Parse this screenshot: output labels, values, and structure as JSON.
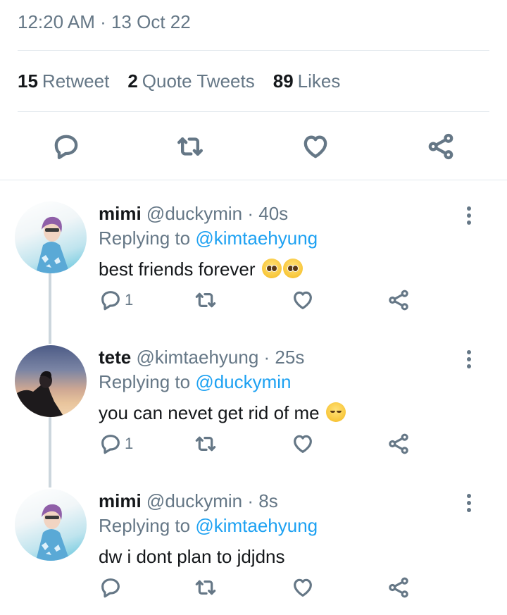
{
  "tweet": {
    "timestamp": "12:20 AM · 13 Oct 22",
    "stats": {
      "retweets_count": "15",
      "retweets_label": "Retweet",
      "quotes_count": "2",
      "quotes_label": "Quote Tweets",
      "likes_count": "89",
      "likes_label": "Likes"
    },
    "actions": [
      "reply-icon",
      "retweet-icon",
      "like-icon",
      "share-icon"
    ]
  },
  "colors": {
    "secondary_text": "#657786",
    "mention": "#1da1f2",
    "divider": "#e1e8ed",
    "thread_line": "#ccd6dd"
  },
  "replies": [
    {
      "name": "mimi",
      "handle": "@duckymin",
      "time": "· 40s",
      "replying_prefix": "Replying to",
      "replying_to": "@kimtaehyung",
      "text": "best friends forever",
      "emoji": [
        "pleading-face-emoji",
        "pleading-face-emoji"
      ],
      "reply_count": "1"
    },
    {
      "name": "tete",
      "handle": "@kimtaehyung",
      "time": "· 25s",
      "replying_prefix": "Replying to",
      "replying_to": "@duckymin",
      "text": "you can nevet get rid of me",
      "emoji": [
        "relieved-face-emoji"
      ],
      "reply_count": "1"
    },
    {
      "name": "mimi",
      "handle": "@duckymin",
      "time": "· 8s",
      "replying_prefix": "Replying to",
      "replying_to": "@kimtaehyung",
      "text": "dw i dont plan to jdjdns",
      "emoji": [],
      "reply_count": ""
    }
  ]
}
